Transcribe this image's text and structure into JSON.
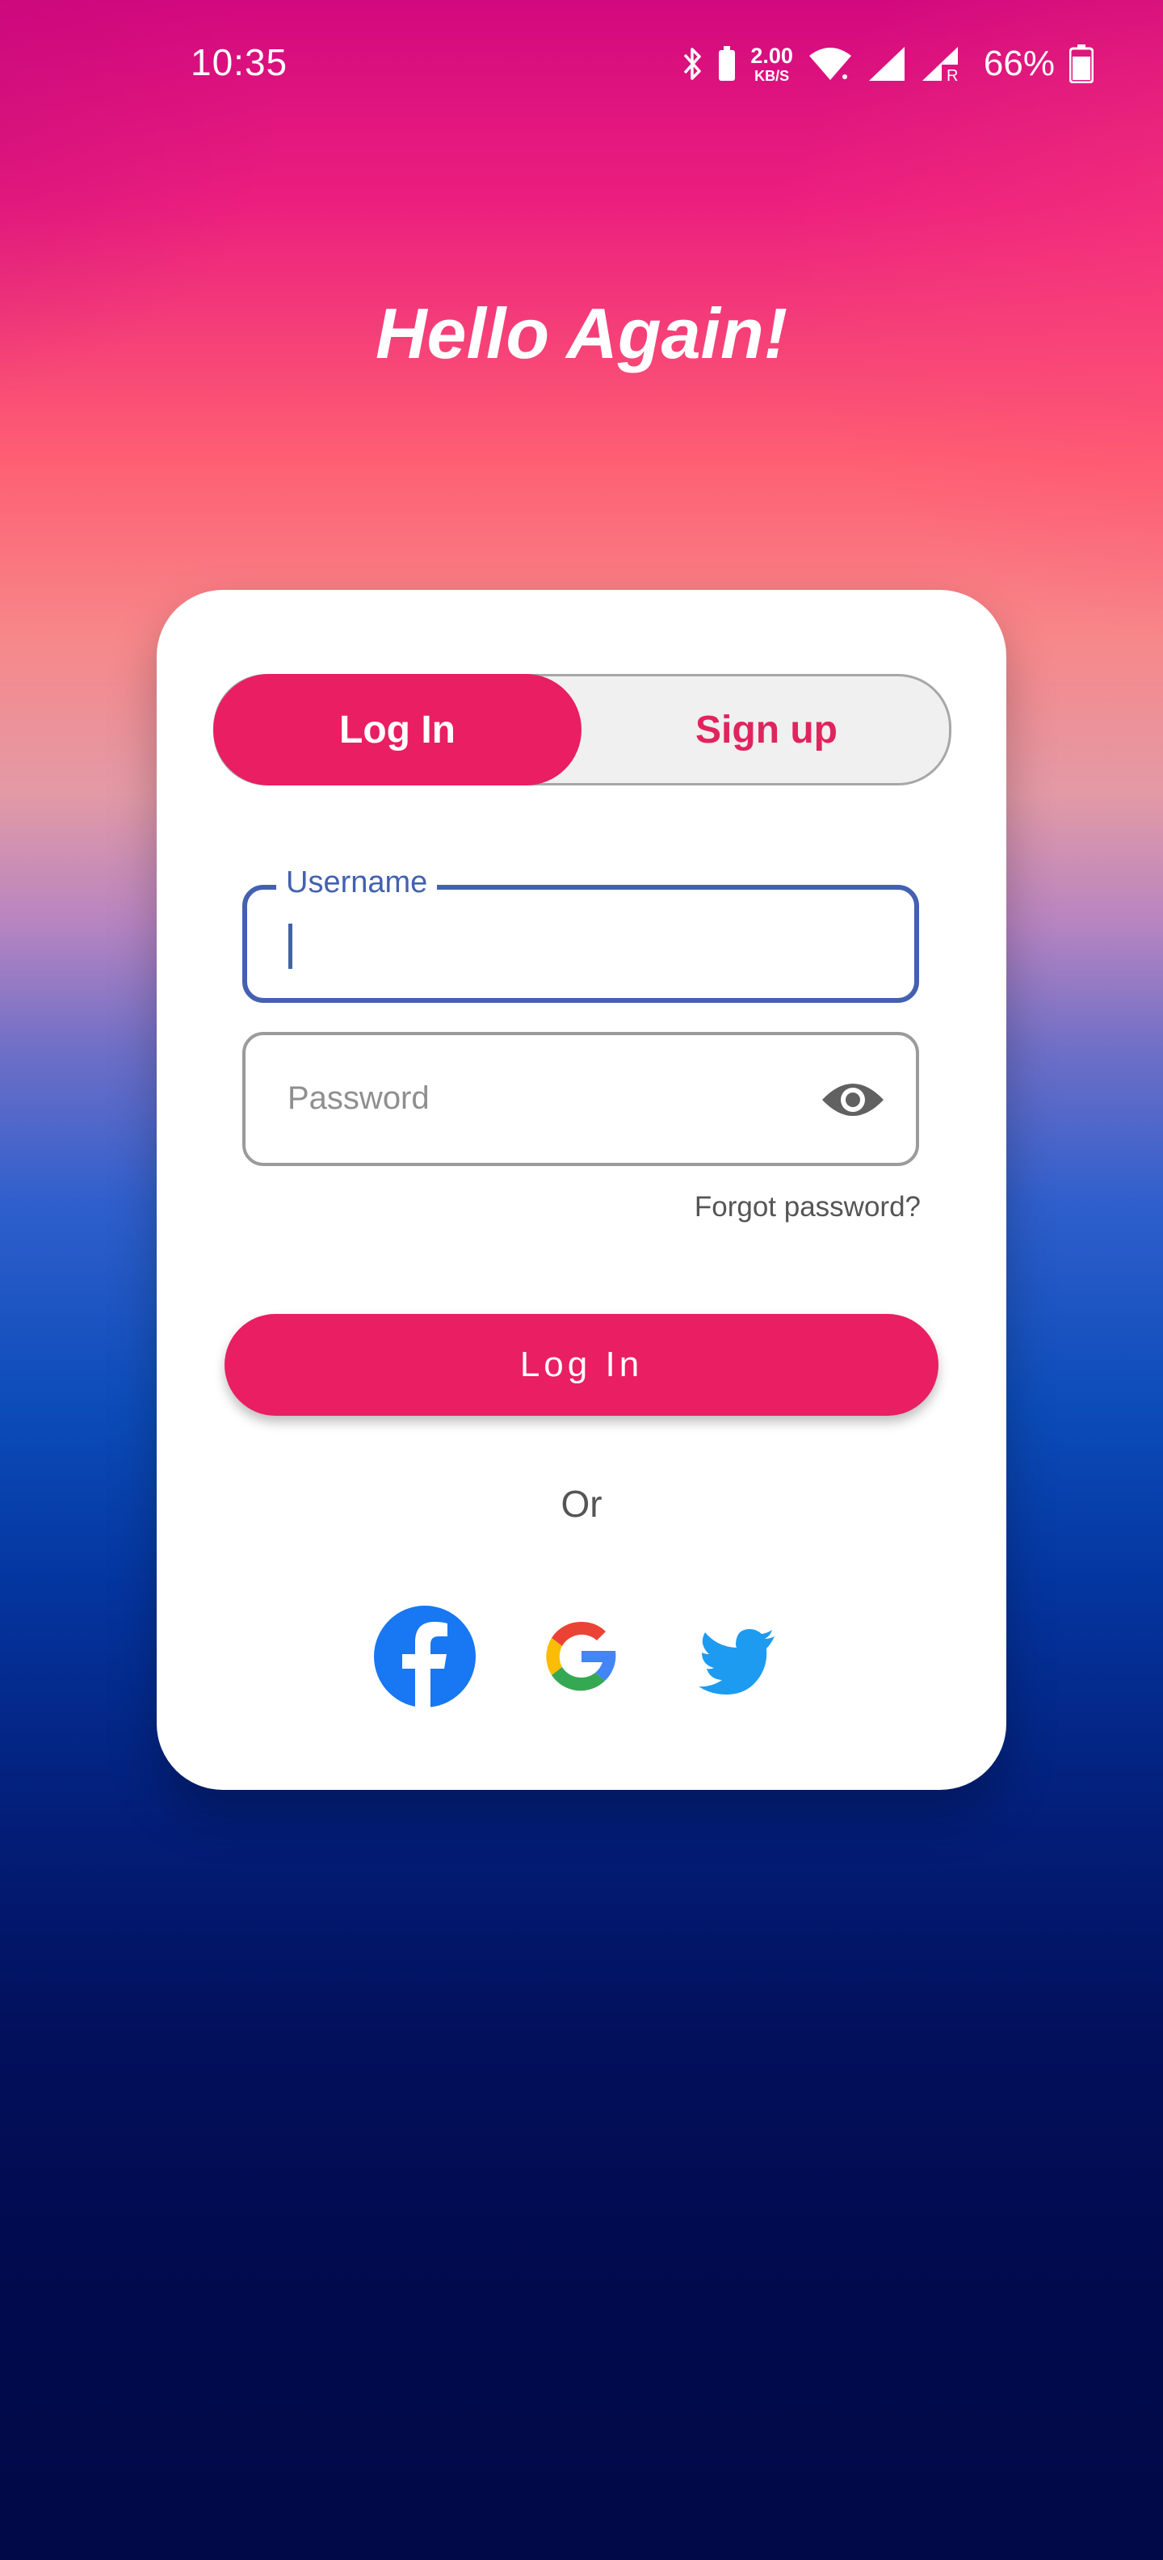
{
  "status_bar": {
    "time": "10:35",
    "net_speed_value": "2.00",
    "net_speed_unit": "KB/S",
    "battery_percent": "66%",
    "icons": [
      "bluetooth-icon",
      "battery-saver-icon",
      "wifi-icon",
      "signal-icon",
      "signal-roaming-icon",
      "battery-icon"
    ]
  },
  "heading": "Hello Again!",
  "tabs": {
    "login": "Log In",
    "signup": "Sign up",
    "active": "login"
  },
  "username": {
    "label": "Username",
    "value": ""
  },
  "password": {
    "placeholder": "Password",
    "value": ""
  },
  "forgot_password": "Forgot password?",
  "login_button": "Log In",
  "separator": "Or",
  "social_logins": [
    "facebook-icon",
    "google-icon",
    "twitter-icon"
  ],
  "colors": {
    "accent": "#e91e63",
    "focus": "#4361b0",
    "facebook": "#1877f2",
    "twitter": "#1d9bf0"
  }
}
